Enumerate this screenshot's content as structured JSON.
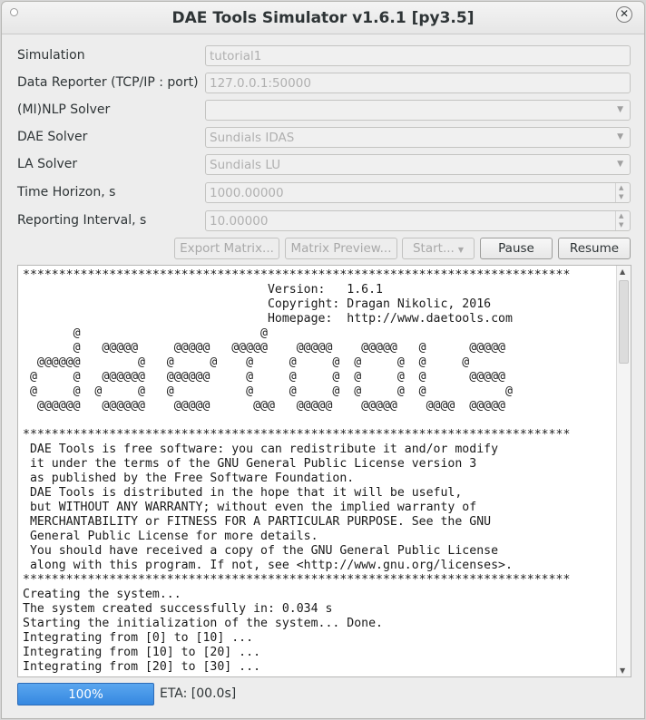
{
  "window": {
    "title": "DAE Tools Simulator v1.6.1 [py3.5]"
  },
  "form": {
    "simulation": {
      "label": "Simulation",
      "value": "tutorial1"
    },
    "data_reporter": {
      "label": "Data Reporter (TCP/IP : port)",
      "value": "127.0.0.1:50000"
    },
    "minlp_solver": {
      "label": "(MI)NLP Solver",
      "value": ""
    },
    "dae_solver": {
      "label": "DAE Solver",
      "value": "Sundials IDAS"
    },
    "la_solver": {
      "label": "LA Solver",
      "value": "Sundials LU"
    },
    "time_horizon": {
      "label": "Time Horizon, s",
      "value": "1000.00000"
    },
    "reporting_interval": {
      "label": "Reporting Interval, s",
      "value": "10.00000"
    }
  },
  "buttons": {
    "export_matrix": "Export Matrix...",
    "matrix_preview": "Matrix Preview...",
    "start": "Start...",
    "pause": "Pause",
    "resume": "Resume"
  },
  "log": {
    "lines": [
      "****************************************************************************",
      "                                  Version:   1.6.1",
      "                                  Copyright: Dragan Nikolic, 2016",
      "                                  Homepage:  http://www.daetools.com",
      "       @                         @",
      "       @   @@@@@     @@@@@   @@@@@    @@@@@    @@@@@   @      @@@@@",
      "  @@@@@@        @   @     @    @     @     @  @     @  @     @",
      " @     @   @@@@@@   @@@@@@     @     @     @  @     @  @      @@@@@",
      " @     @  @     @   @          @     @     @  @     @  @           @",
      "  @@@@@@   @@@@@@    @@@@@      @@@   @@@@@    @@@@@    @@@@  @@@@@",
      "",
      "****************************************************************************",
      " DAE Tools is free software: you can redistribute it and/or modify",
      " it under the terms of the GNU General Public License version 3",
      " as published by the Free Software Foundation.",
      " DAE Tools is distributed in the hope that it will be useful,",
      " but WITHOUT ANY WARRANTY; without even the implied warranty of",
      " MERCHANTABILITY or FITNESS FOR A PARTICULAR PURPOSE. See the GNU",
      " General Public License for more details.",
      " You should have received a copy of the GNU General Public License",
      " along with this program. If not, see <http://www.gnu.org/licenses>.",
      "****************************************************************************",
      "Creating the system...",
      "The system created successfully in: 0.034 s",
      "Starting the initialization of the system... Done.",
      "Integrating from [0] to [10] ...",
      "Integrating from [10] to [20] ...",
      "Integrating from [20] to [30] ..."
    ]
  },
  "status": {
    "progress_label": "100%",
    "progress_value": 1.0,
    "eta": "ETA: [00.0s]"
  },
  "colors": {
    "progress_fill": "#3d8fe4",
    "window_bg": "#ededed",
    "log_bg": "#ffffff"
  }
}
